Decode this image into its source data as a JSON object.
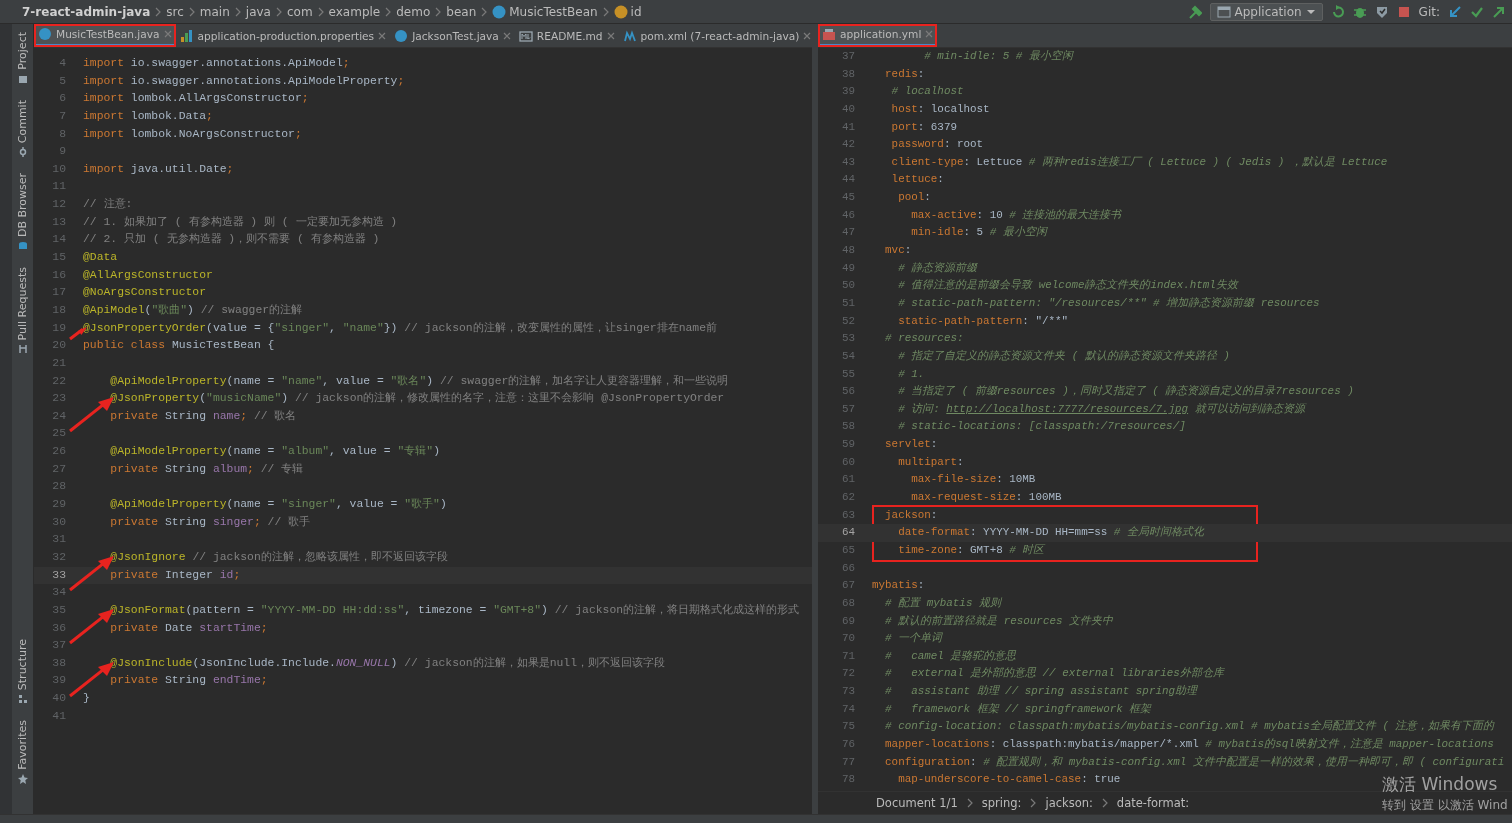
{
  "navigation_bar": {
    "breadcrumbs": [
      {
        "label": "7-react-admin-java",
        "kind": "project"
      },
      {
        "label": "src",
        "kind": "folder"
      },
      {
        "label": "main",
        "kind": "folder"
      },
      {
        "label": "java",
        "kind": "folder"
      },
      {
        "label": "com",
        "kind": "folder"
      },
      {
        "label": "example",
        "kind": "folder"
      },
      {
        "label": "demo",
        "kind": "folder"
      },
      {
        "label": "bean",
        "kind": "folder"
      },
      {
        "label": "MusicTestBean",
        "kind": "class"
      },
      {
        "label": "id",
        "kind": "field"
      }
    ],
    "run_configuration": "Application",
    "vcs_label": "Git:"
  },
  "tool_window_bar": {
    "top": [
      "Project",
      "Commit",
      "DB Browser",
      "Pull Requests"
    ],
    "bottom": [
      "Structure",
      "Favorites"
    ]
  },
  "editors": [
    {
      "tabs": [
        {
          "label": "MusicTestBean.java",
          "kind": "class",
          "selected": true,
          "outlined": true
        },
        {
          "label": "application-production.properties",
          "kind": "properties",
          "selected": false,
          "outlined": false
        },
        {
          "label": "JacksonTest.java",
          "kind": "class",
          "selected": false,
          "outlined": false
        },
        {
          "label": "README.md",
          "kind": "markdown",
          "selected": false,
          "outlined": false
        },
        {
          "label": "pom.xml (7-react-admin-java)",
          "kind": "maven",
          "selected": false,
          "outlined": false
        }
      ],
      "lines": [
        {
          "number": "4",
          "current": false,
          "arrow": false,
          "tokens": [
            {
              "kind": "keyword",
              "text": "import "
            },
            {
              "kind": "plain",
              "text": "io.swagger.annotations.ApiModel"
            },
            {
              "kind": "keyword",
              "text": ";"
            }
          ]
        },
        {
          "number": "5",
          "current": false,
          "arrow": false,
          "tokens": [
            {
              "kind": "keyword",
              "text": "import "
            },
            {
              "kind": "plain",
              "text": "io.swagger.annotations.ApiModelProperty"
            },
            {
              "kind": "keyword",
              "text": ";"
            }
          ]
        },
        {
          "number": "6",
          "current": false,
          "arrow": false,
          "tokens": [
            {
              "kind": "keyword",
              "text": "import "
            },
            {
              "kind": "plain",
              "text": "lombok.AllArgsConstructor"
            },
            {
              "kind": "keyword",
              "text": ";"
            }
          ]
        },
        {
          "number": "7",
          "current": false,
          "arrow": false,
          "tokens": [
            {
              "kind": "keyword",
              "text": "import "
            },
            {
              "kind": "plain",
              "text": "lombok.Data"
            },
            {
              "kind": "keyword",
              "text": ";"
            }
          ]
        },
        {
          "number": "8",
          "current": false,
          "arrow": false,
          "tokens": [
            {
              "kind": "keyword",
              "text": "import "
            },
            {
              "kind": "plain",
              "text": "lombok.NoArgsConstructor"
            },
            {
              "kind": "keyword",
              "text": ";"
            }
          ]
        },
        {
          "number": "9",
          "current": false,
          "arrow": false
        },
        {
          "number": "10",
          "current": false,
          "arrow": false,
          "tokens": [
            {
              "kind": "keyword",
              "text": "import "
            },
            {
              "kind": "plain",
              "text": "java.util.Date"
            },
            {
              "kind": "keyword",
              "text": ";"
            }
          ]
        },
        {
          "number": "11",
          "current": false,
          "arrow": false
        },
        {
          "number": "12",
          "current": false,
          "arrow": false,
          "tokens": [
            {
              "kind": "comment",
              "text": "// 注意:"
            }
          ]
        },
        {
          "number": "13",
          "current": false,
          "arrow": false,
          "tokens": [
            {
              "kind": "comment",
              "text": "// 1. 如果加了 ( 有参构造器 ) 则 ( 一定要加无参构造 )"
            }
          ]
        },
        {
          "number": "14",
          "current": false,
          "arrow": false,
          "tokens": [
            {
              "kind": "comment",
              "text": "// 2. 只加 ( 无参构造器 )，则不需要 ( 有参构造器 )"
            }
          ]
        },
        {
          "number": "15",
          "current": false,
          "arrow": false,
          "tokens": [
            {
              "kind": "annotation",
              "text": "@Data"
            }
          ]
        },
        {
          "number": "16",
          "current": false,
          "arrow": false,
          "tokens": [
            {
              "kind": "annotation",
              "text": "@AllArgsConstructor"
            }
          ]
        },
        {
          "number": "17",
          "current": false,
          "arrow": false,
          "tokens": [
            {
              "kind": "annotation",
              "text": "@NoArgsConstructor"
            }
          ]
        },
        {
          "number": "18",
          "current": false,
          "arrow": false,
          "tokens": [
            {
              "kind": "annotation",
              "text": "@ApiModel"
            },
            {
              "kind": "plain",
              "text": "("
            },
            {
              "kind": "string",
              "text": "\"歌曲\""
            },
            {
              "kind": "plain",
              "text": ")"
            },
            {
              "kind": "comment",
              "text": " // swagger的注解"
            }
          ]
        },
        {
          "number": "19",
          "current": false,
          "arrow": true,
          "tokens": [
            {
              "kind": "annotation",
              "text": "@JsonPropertyOrder"
            },
            {
              "kind": "plain",
              "text": "(value = {"
            },
            {
              "kind": "string",
              "text": "\"singer\""
            },
            {
              "kind": "plain",
              "text": ", "
            },
            {
              "kind": "string",
              "text": "\"name\""
            },
            {
              "kind": "plain",
              "text": "})"
            },
            {
              "kind": "comment",
              "text": " // jackson的注解，改变属性的属性，让singer排在name前"
            }
          ]
        },
        {
          "number": "20",
          "current": false,
          "arrow": false,
          "tokens": [
            {
              "kind": "keyword",
              "text": "public class "
            },
            {
              "kind": "plain",
              "text": "MusicTestBean {"
            }
          ]
        },
        {
          "number": "21",
          "current": false,
          "arrow": false
        },
        {
          "number": "22",
          "current": false,
          "arrow": false,
          "tokens": [
            {
              "kind": "annotation",
              "text": "    @ApiModelProperty"
            },
            {
              "kind": "plain",
              "text": "(name = "
            },
            {
              "kind": "string",
              "text": "\"name\""
            },
            {
              "kind": "plain",
              "text": ", value = "
            },
            {
              "kind": "string",
              "text": "\"歌名\""
            },
            {
              "kind": "plain",
              "text": ")"
            },
            {
              "kind": "comment",
              "text": " // swagger的注解，加名字让人更容器理解，和一些说明"
            }
          ]
        },
        {
          "number": "23",
          "current": false,
          "arrow": true,
          "tokens": [
            {
              "kind": "annotation",
              "text": "    @JsonProperty"
            },
            {
              "kind": "plain",
              "text": "("
            },
            {
              "kind": "string",
              "text": "\"musicName\""
            },
            {
              "kind": "plain",
              "text": ")"
            },
            {
              "kind": "comment",
              "text": " // jackson的注解，修改属性的名字，注意：这里不会影响 @JsonPropertyOrder"
            }
          ]
        },
        {
          "number": "24",
          "current": false,
          "arrow": false,
          "tokens": [
            {
              "kind": "keyword",
              "text": "    private "
            },
            {
              "kind": "plain",
              "text": "String "
            },
            {
              "kind": "field",
              "text": "name"
            },
            {
              "kind": "keyword",
              "text": ";"
            },
            {
              "kind": "comment",
              "text": " // 歌名"
            }
          ]
        },
        {
          "number": "25",
          "current": false,
          "arrow": false
        },
        {
          "number": "26",
          "current": false,
          "arrow": false,
          "tokens": [
            {
              "kind": "annotation",
              "text": "    @ApiModelProperty"
            },
            {
              "kind": "plain",
              "text": "(name = "
            },
            {
              "kind": "string",
              "text": "\"album\""
            },
            {
              "kind": "plain",
              "text": ", value = "
            },
            {
              "kind": "string",
              "text": "\"专辑\""
            },
            {
              "kind": "plain",
              "text": ")"
            }
          ]
        },
        {
          "number": "27",
          "current": false,
          "arrow": false,
          "tokens": [
            {
              "kind": "keyword",
              "text": "    private "
            },
            {
              "kind": "plain",
              "text": "String "
            },
            {
              "kind": "field",
              "text": "album"
            },
            {
              "kind": "keyword",
              "text": ";"
            },
            {
              "kind": "comment",
              "text": " // 专辑"
            }
          ]
        },
        {
          "number": "28",
          "current": false,
          "arrow": false
        },
        {
          "number": "29",
          "current": false,
          "arrow": false,
          "tokens": [
            {
              "kind": "annotation",
              "text": "    @ApiModelProperty"
            },
            {
              "kind": "plain",
              "text": "(name = "
            },
            {
              "kind": "string",
              "text": "\"singer\""
            },
            {
              "kind": "plain",
              "text": ", value = "
            },
            {
              "kind": "string",
              "text": "\"歌手\""
            },
            {
              "kind": "plain",
              "text": ")"
            }
          ]
        },
        {
          "number": "30",
          "current": false,
          "arrow": false,
          "tokens": [
            {
              "kind": "keyword",
              "text": "    private "
            },
            {
              "kind": "plain",
              "text": "String "
            },
            {
              "kind": "field",
              "text": "singer"
            },
            {
              "kind": "keyword",
              "text": ";"
            },
            {
              "kind": "comment",
              "text": " // 歌手"
            }
          ]
        },
        {
          "number": "31",
          "current": false,
          "arrow": false
        },
        {
          "number": "32",
          "current": false,
          "arrow": true,
          "tokens": [
            {
              "kind": "annotation",
              "text": "    @JsonIgnore"
            },
            {
              "kind": "comment",
              "text": " // jackson的注解，忽略该属性，即不返回该字段"
            }
          ]
        },
        {
          "number": "33",
          "current": true,
          "arrow": false,
          "tokens": [
            {
              "kind": "keyword",
              "text": "    private "
            },
            {
              "kind": "plain",
              "text": "Integer "
            },
            {
              "kind": "field",
              "text": "id"
            },
            {
              "kind": "keyword",
              "text": ";"
            }
          ]
        },
        {
          "number": "34",
          "current": false,
          "arrow": false
        },
        {
          "number": "35",
          "current": false,
          "arrow": true,
          "tokens": [
            {
              "kind": "annotation",
              "text": "    @JsonFormat"
            },
            {
              "kind": "plain",
              "text": "(pattern = "
            },
            {
              "kind": "string",
              "text": "\"YYYY-MM-DD HH:dd:ss\""
            },
            {
              "kind": "plain",
              "text": ", timezone = "
            },
            {
              "kind": "string",
              "text": "\"GMT+8\""
            },
            {
              "kind": "plain",
              "text": ")"
            },
            {
              "kind": "comment",
              "text": " // jackson的注解，将日期格式化成这样的形式"
            }
          ]
        },
        {
          "number": "36",
          "current": false,
          "arrow": false,
          "tokens": [
            {
              "kind": "keyword",
              "text": "    private "
            },
            {
              "kind": "plain",
              "text": "Date "
            },
            {
              "kind": "field",
              "text": "startTime"
            },
            {
              "kind": "keyword",
              "text": ";"
            }
          ]
        },
        {
          "number": "37",
          "current": false,
          "arrow": false
        },
        {
          "number": "38",
          "current": false,
          "arrow": true,
          "tokens": [
            {
              "kind": "annotation",
              "text": "    @JsonInclude"
            },
            {
              "kind": "plain",
              "text": "(JsonInclude.Include."
            },
            {
              "kind": "constant",
              "text": "NON_NULL"
            },
            {
              "kind": "plain",
              "text": ")"
            },
            {
              "kind": "comment",
              "text": " // jackson的注解，如果是null，则不返回该字段"
            }
          ]
        },
        {
          "number": "39",
          "current": false,
          "arrow": false,
          "tokens": [
            {
              "kind": "keyword",
              "text": "    private "
            },
            {
              "kind": "plain",
              "text": "String "
            },
            {
              "kind": "field",
              "text": "endTime"
            },
            {
              "kind": "keyword",
              "text": ";"
            }
          ]
        },
        {
          "number": "40",
          "current": false,
          "arrow": false,
          "tokens": [
            {
              "kind": "plain",
              "text": "}"
            }
          ]
        },
        {
          "number": "41",
          "current": false,
          "arrow": false
        }
      ]
    },
    {
      "tabs": [
        {
          "label": "application.yml",
          "kind": "yaml",
          "selected": true,
          "outlined": true
        }
      ],
      "lines": [
        {
          "number": "37",
          "current": false,
          "boxed": false,
          "tokens": [
            {
              "kind": "comment",
              "text": "        # min-idle: 5 # 最小空闲"
            }
          ]
        },
        {
          "number": "38",
          "current": false,
          "boxed": false,
          "tokens": [
            {
              "kind": "key",
              "text": "  redis"
            },
            {
              "kind": "plain",
              "text": ":"
            }
          ]
        },
        {
          "number": "39",
          "current": false,
          "boxed": false,
          "tokens": [
            {
              "kind": "comment",
              "text": "   # localhost"
            }
          ]
        },
        {
          "number": "40",
          "current": false,
          "boxed": false,
          "tokens": [
            {
              "kind": "key",
              "text": "   host"
            },
            {
              "kind": "plain",
              "text": ": localhost"
            }
          ]
        },
        {
          "number": "41",
          "current": false,
          "boxed": false,
          "tokens": [
            {
              "kind": "key",
              "text": "   port"
            },
            {
              "kind": "plain",
              "text": ": 6379"
            }
          ]
        },
        {
          "number": "42",
          "current": false,
          "boxed": false,
          "tokens": [
            {
              "kind": "key",
              "text": "   password"
            },
            {
              "kind": "plain",
              "text": ": root"
            }
          ]
        },
        {
          "number": "43",
          "current": false,
          "boxed": false,
          "tokens": [
            {
              "kind": "key",
              "text": "   client-type"
            },
            {
              "kind": "plain",
              "text": ": Lettuce "
            },
            {
              "kind": "comment",
              "text": "# 两种redis连接工厂 ( Lettuce ) ( Jedis ) ，默认是 Lettuce"
            }
          ]
        },
        {
          "number": "44",
          "current": false,
          "boxed": false,
          "tokens": [
            {
              "kind": "key",
              "text": "   lettuce"
            },
            {
              "kind": "plain",
              "text": ":"
            }
          ]
        },
        {
          "number": "45",
          "current": false,
          "boxed": false,
          "tokens": [
            {
              "kind": "key",
              "text": "    pool"
            },
            {
              "kind": "plain",
              "text": ":"
            }
          ]
        },
        {
          "number": "46",
          "current": false,
          "boxed": false,
          "tokens": [
            {
              "kind": "key",
              "text": "      max-active"
            },
            {
              "kind": "plain",
              "text": ": 10 "
            },
            {
              "kind": "comment",
              "text": "# 连接池的最大连接书"
            }
          ]
        },
        {
          "number": "47",
          "current": false,
          "boxed": false,
          "tokens": [
            {
              "kind": "key",
              "text": "      min-idle"
            },
            {
              "kind": "plain",
              "text": ": 5 "
            },
            {
              "kind": "comment",
              "text": "# 最小空闲"
            }
          ]
        },
        {
          "number": "48",
          "current": false,
          "boxed": false,
          "tokens": [
            {
              "kind": "key",
              "text": "  mvc"
            },
            {
              "kind": "plain",
              "text": ":"
            }
          ]
        },
        {
          "number": "49",
          "current": false,
          "boxed": false,
          "tokens": [
            {
              "kind": "comment",
              "text": "    # 静态资源前缀"
            }
          ]
        },
        {
          "number": "50",
          "current": false,
          "boxed": false,
          "tokens": [
            {
              "kind": "comment",
              "text": "    # 值得注意的是前缀会导致 welcome静态文件夹的index.html失效"
            }
          ]
        },
        {
          "number": "51",
          "current": false,
          "boxed": false,
          "tokens": [
            {
              "kind": "comment",
              "text": "    # static-path-pattern: \"/resources/**\" # 增加静态资源前缀 resources"
            }
          ]
        },
        {
          "number": "52",
          "current": false,
          "boxed": false,
          "tokens": [
            {
              "kind": "key",
              "text": "    static-path-pattern"
            },
            {
              "kind": "plain",
              "text": ": \"/**\""
            }
          ]
        },
        {
          "number": "53",
          "current": false,
          "boxed": false,
          "tokens": [
            {
              "kind": "comment",
              "text": "  # resources:"
            }
          ]
        },
        {
          "number": "54",
          "current": false,
          "boxed": false,
          "tokens": [
            {
              "kind": "comment",
              "text": "    # 指定了自定义的静态资源文件夹 ( 默认的静态资源文件夹路径 )"
            }
          ]
        },
        {
          "number": "55",
          "current": false,
          "boxed": false,
          "tokens": [
            {
              "kind": "comment",
              "text": "    # 1."
            }
          ]
        },
        {
          "number": "56",
          "current": false,
          "boxed": false,
          "tokens": [
            {
              "kind": "comment",
              "text": "    # 当指定了 ( 前缀resources )，同时又指定了 ( 静态资源自定义的目录7resources )"
            }
          ]
        },
        {
          "number": "57",
          "current": false,
          "boxed": false,
          "tokens": [
            {
              "kind": "comment",
              "text": "    # 访问: "
            },
            {
              "kind": "link",
              "text": "http://localhost:7777/resources/7.jpg"
            },
            {
              "kind": "comment",
              "text": " 就可以访问到静态资源"
            }
          ]
        },
        {
          "number": "58",
          "current": false,
          "boxed": false,
          "tokens": [
            {
              "kind": "comment",
              "text": "    # static-locations: [classpath:/7resources/]"
            }
          ]
        },
        {
          "number": "59",
          "current": false,
          "boxed": false,
          "tokens": [
            {
              "kind": "key",
              "text": "  servlet"
            },
            {
              "kind": "plain",
              "text": ":"
            }
          ]
        },
        {
          "number": "60",
          "current": false,
          "boxed": false,
          "tokens": [
            {
              "kind": "key",
              "text": "    multipart"
            },
            {
              "kind": "plain",
              "text": ":"
            }
          ]
        },
        {
          "number": "61",
          "current": false,
          "boxed": false,
          "tokens": [
            {
              "kind": "key",
              "text": "      max-file-size"
            },
            {
              "kind": "plain",
              "text": ": 10MB"
            }
          ]
        },
        {
          "number": "62",
          "current": false,
          "boxed": false,
          "tokens": [
            {
              "kind": "key",
              "text": "      max-request-size"
            },
            {
              "kind": "plain",
              "text": ": 100MB"
            }
          ]
        },
        {
          "number": "63",
          "current": false,
          "boxed": true,
          "tokens": [
            {
              "kind": "key",
              "text": "  jackson"
            },
            {
              "kind": "plain",
              "text": ":"
            }
          ]
        },
        {
          "number": "64",
          "current": true,
          "boxed": true,
          "tokens": [
            {
              "kind": "key",
              "text": "    date-format"
            },
            {
              "kind": "plain",
              "text": ": YYYY-MM-DD HH=mm=ss "
            },
            {
              "kind": "comment",
              "text": "# 全局时间格式化"
            }
          ]
        },
        {
          "number": "65",
          "current": false,
          "boxed": true,
          "tokens": [
            {
              "kind": "key",
              "text": "    time-zone"
            },
            {
              "kind": "plain",
              "text": ": GMT+8 "
            },
            {
              "kind": "comment",
              "text": "# 时区"
            }
          ]
        },
        {
          "number": "66",
          "current": false,
          "boxed": false
        },
        {
          "number": "67",
          "current": false,
          "boxed": false,
          "tokens": [
            {
              "kind": "key",
              "text": "mybatis"
            },
            {
              "kind": "plain",
              "text": ":"
            }
          ]
        },
        {
          "number": "68",
          "current": false,
          "boxed": false,
          "tokens": [
            {
              "kind": "comment",
              "text": "  # 配置 mybatis 规则"
            }
          ]
        },
        {
          "number": "69",
          "current": false,
          "boxed": false,
          "tokens": [
            {
              "kind": "comment",
              "text": "  # 默认的前置路径就是 resources 文件夹中"
            }
          ]
        },
        {
          "number": "70",
          "current": false,
          "boxed": false,
          "tokens": [
            {
              "kind": "comment",
              "text": "  # 一个单词"
            }
          ]
        },
        {
          "number": "71",
          "current": false,
          "boxed": false,
          "tokens": [
            {
              "kind": "comment",
              "text": "  #   camel 是骆驼的意思"
            }
          ]
        },
        {
          "number": "72",
          "current": false,
          "boxed": false,
          "tokens": [
            {
              "kind": "comment",
              "text": "  #   external 是外部的意思 // external libraries外部仓库"
            }
          ]
        },
        {
          "number": "73",
          "current": false,
          "boxed": false,
          "tokens": [
            {
              "kind": "comment",
              "text": "  #   assistant 助理 // spring assistant spring助理"
            }
          ]
        },
        {
          "number": "74",
          "current": false,
          "boxed": false,
          "tokens": [
            {
              "kind": "comment",
              "text": "  #   framework 框架 // springframework 框架"
            }
          ]
        },
        {
          "number": "75",
          "current": false,
          "boxed": false,
          "tokens": [
            {
              "kind": "comment",
              "text": "  # config-location: classpath:mybatis/mybatis-config.xml # mybatis全局配置文件 ( 注意，如果有下面的"
            }
          ]
        },
        {
          "number": "76",
          "current": false,
          "boxed": false,
          "tokens": [
            {
              "kind": "key",
              "text": "  mapper-locations"
            },
            {
              "kind": "plain",
              "text": ": classpath:mybatis/mapper/*.xml "
            },
            {
              "kind": "comment",
              "text": "# mybatis的sql映射文件，注意是 mapper-locations"
            }
          ]
        },
        {
          "number": "77",
          "current": false,
          "boxed": false,
          "tokens": [
            {
              "kind": "key",
              "text": "  configuration"
            },
            {
              "kind": "plain",
              "text": ": "
            },
            {
              "kind": "comment",
              "text": "# 配置规则，和 mybatis-config.xml 文件中配置是一样的效果，使用一种即可，即 ( configurati"
            }
          ]
        },
        {
          "number": "78",
          "current": false,
          "boxed": false,
          "tokens": [
            {
              "kind": "key",
              "text": "    map-underscore-to-camel-case"
            },
            {
              "kind": "plain",
              "text": ": true"
            }
          ]
        }
      ],
      "breadcrumbs": [
        "Document 1/1",
        "spring:",
        "jackson:",
        "date-format:"
      ]
    }
  ],
  "windows_activation": {
    "title": "激活 Windows",
    "hint": "转到 设置 以激活 Wind"
  }
}
